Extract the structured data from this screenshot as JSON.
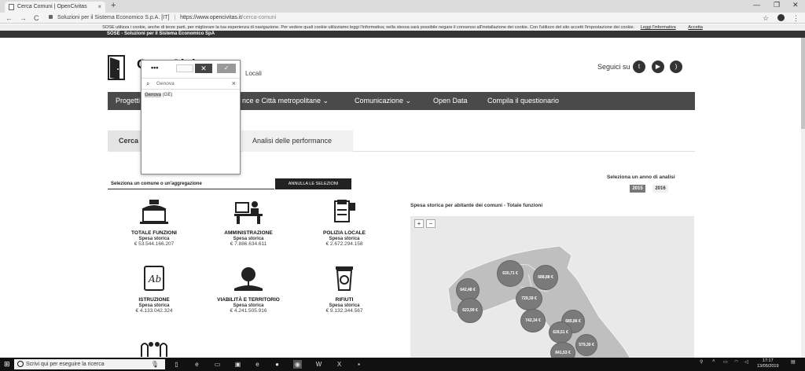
{
  "browser": {
    "tab_title": "Cerca Comuni | OpenCivitas",
    "tab_close": "×",
    "new_tab": "+",
    "window_controls": [
      "—",
      "❐",
      "✕"
    ],
    "nav": [
      "←",
      "→",
      "C"
    ],
    "site_owner": "Soluzioni per il Sistema Economico S.p.A. [IT]",
    "separator": "|",
    "url_domain": "https://www.opencivitas.it",
    "url_path": "/cerca-comuni",
    "bookmark_icon": "☆",
    "menu_icon": "⋮"
  },
  "cookie_banner": {
    "text": "SOSE utilizza i cookie, anche di terze parti, per migliorare la tua esperienza di navigazione. Per vedere quali cookie utilizziamo leggi l'informativa; nella stessa sarà possibile negare il consenso all'installazione dei cookie. Con l'utilizzo del sito accetti l'impostazione dei cookie.",
    "link": "Leggi l'informativa",
    "accept": "Accetta"
  },
  "top_strip": "SOSE - Soluzioni per il Sistema Economico SpA",
  "header": {
    "title": "OpenCivitas",
    "subtitle": "Locali",
    "follow": "Seguici su",
    "social": [
      "twitter-icon",
      "youtube-icon",
      "rss-icon"
    ]
  },
  "mainnav": {
    "items": [
      "Progetti",
      "nce e Città metropolitane ⌄",
      "Comunicazione ⌄",
      "Open Data",
      "Compila il questionario"
    ]
  },
  "tabs": {
    "cerca": "Cerca",
    "analisi": "Analisi delle performance"
  },
  "search": {
    "placeholder": "Seleziona un comune o un'aggregazione",
    "clear_button": "ANNULLA LE SELEZIONI"
  },
  "years": {
    "label": "Seleziona un anno di analisi",
    "options": [
      "2015",
      "2016"
    ],
    "selected": "2015"
  },
  "functions": [
    {
      "name": "TOTALE FUNZIONI",
      "sub": "Spesa storica",
      "value": "€ 53.544.166.207",
      "icon": "city-hall-icon"
    },
    {
      "name": "AMMINISTRAZIONE",
      "sub": "Spesa storica",
      "value": "€ 7.886.634.611",
      "icon": "desk-icon"
    },
    {
      "name": "POLIZIA LOCALE",
      "sub": "Spesa storica",
      "value": "€ 2.672.294.158",
      "icon": "police-icon"
    },
    {
      "name": "ISTRUZIONE",
      "sub": "Spesa storica",
      "value": "€ 4.133.042.324",
      "icon": "book-icon"
    },
    {
      "name": "VIABILITÀ E TERRITORIO",
      "sub": "Spesa storica",
      "value": "€ 4.241.505.916",
      "icon": "road-tree-icon"
    },
    {
      "name": "RIFIUTI",
      "sub": "Spesa storica",
      "value": "€ 9.132.344.567",
      "icon": "recycle-bin-icon"
    }
  ],
  "map": {
    "title": "Spesa storica per abitante dei comuni - Totale funzioni",
    "zoom_in": "+",
    "zoom_out": "−",
    "bubbles": [
      "630,71 €",
      "688,88 €",
      "642,48 €",
      "729,39 €",
      "623,99 €",
      "742,34 €",
      "685,86 €",
      "628,51 €",
      "579,30 €",
      "841,53 €"
    ]
  },
  "dropdown": {
    "dots": "•••",
    "cancel": "✕",
    "confirm": "✓",
    "query": "Genova",
    "clear": "×",
    "result_match": "Genova",
    "result_rest": " (GE)"
  },
  "taskbar": {
    "search_placeholder": "Scrivi qui per eseguire la ricerca",
    "time": "17:17",
    "date": "13/05/2019"
  }
}
